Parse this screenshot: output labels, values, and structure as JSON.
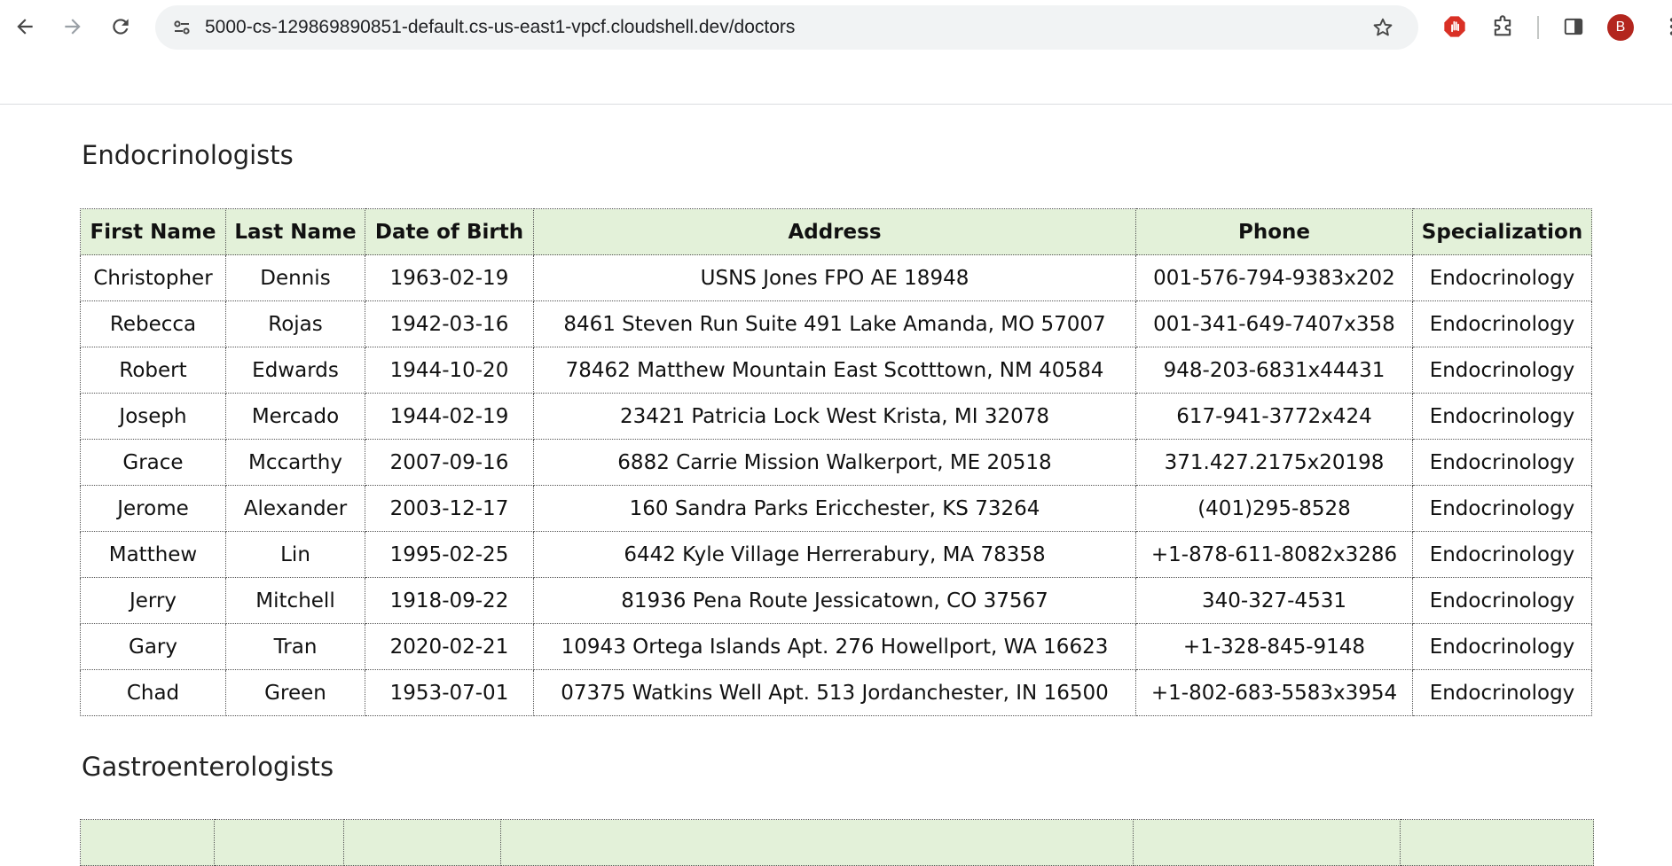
{
  "browser": {
    "url": "5000-cs-129869890851-default.cs-us-east1-vpcf.cloudshell.dev/doctors",
    "avatar_initial": "B"
  },
  "sections": [
    {
      "title": "Endocrinologists",
      "columns": [
        "First Name",
        "Last Name",
        "Date of Birth",
        "Address",
        "Phone",
        "Specialization"
      ],
      "rows": [
        [
          "Christopher",
          "Dennis",
          "1963-02-19",
          "USNS Jones FPO AE 18948",
          "001-576-794-9383x202",
          "Endocrinology"
        ],
        [
          "Rebecca",
          "Rojas",
          "1942-03-16",
          "8461 Steven Run Suite 491 Lake Amanda, MO 57007",
          "001-341-649-7407x358",
          "Endocrinology"
        ],
        [
          "Robert",
          "Edwards",
          "1944-10-20",
          "78462 Matthew Mountain East Scotttown, NM 40584",
          "948-203-6831x44431",
          "Endocrinology"
        ],
        [
          "Joseph",
          "Mercado",
          "1944-02-19",
          "23421 Patricia Lock West Krista, MI 32078",
          "617-941-3772x424",
          "Endocrinology"
        ],
        [
          "Grace",
          "Mccarthy",
          "2007-09-16",
          "6882 Carrie Mission Walkerport, ME 20518",
          "371.427.2175x20198",
          "Endocrinology"
        ],
        [
          "Jerome",
          "Alexander",
          "2003-12-17",
          "160 Sandra Parks Ericchester, KS 73264",
          "(401)295-8528",
          "Endocrinology"
        ],
        [
          "Matthew",
          "Lin",
          "1995-02-25",
          "6442 Kyle Village Herrerabury, MA 78358",
          "+1-878-611-8082x3286",
          "Endocrinology"
        ],
        [
          "Jerry",
          "Mitchell",
          "1918-09-22",
          "81936 Pena Route Jessicatown, CO 37567",
          "340-327-4531",
          "Endocrinology"
        ],
        [
          "Gary",
          "Tran",
          "2020-02-21",
          "10943 Ortega Islands Apt. 276 Howellport, WA 16623",
          "+1-328-845-9148",
          "Endocrinology"
        ],
        [
          "Chad",
          "Green",
          "1953-07-01",
          "07375 Watkins Well Apt. 513 Jordanchester, IN 16500",
          "+1-802-683-5583x3954",
          "Endocrinology"
        ]
      ]
    },
    {
      "title": "Gastroenterologists",
      "columns": [
        "",
        "",
        "",
        "",
        "",
        ""
      ],
      "rows": []
    }
  ]
}
